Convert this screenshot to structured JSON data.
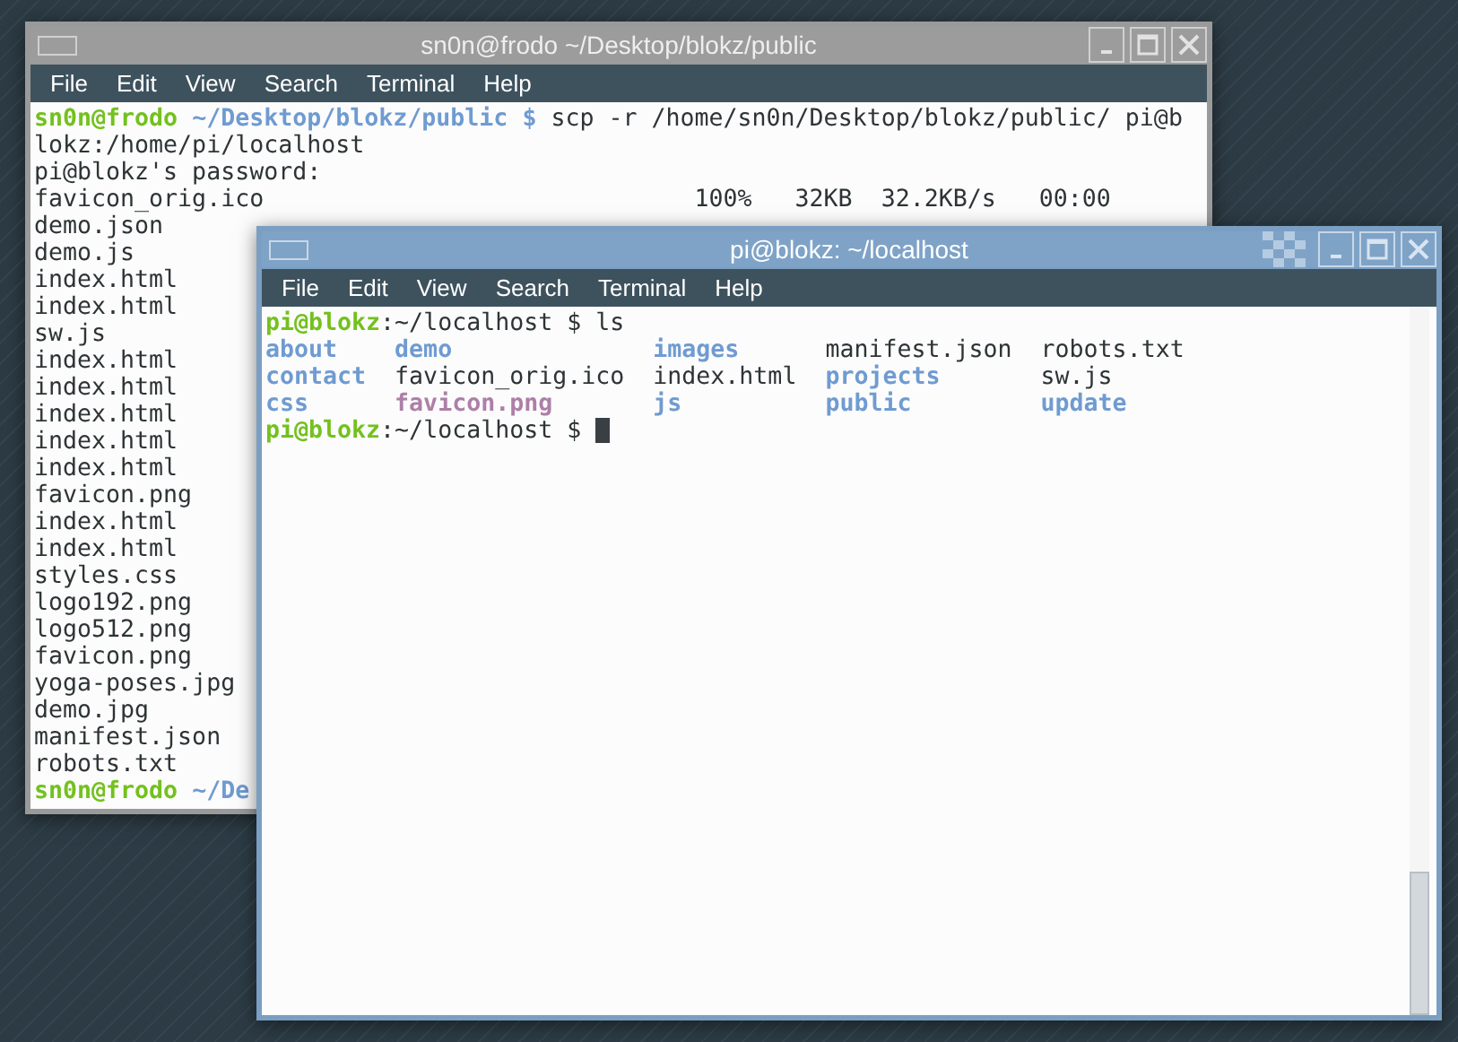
{
  "windows": [
    {
      "title": "sn0n@frodo ~/Desktop/blokz/public",
      "active": false,
      "menu": [
        "File",
        "Edit",
        "View",
        "Search",
        "Terminal",
        "Help"
      ],
      "lines": [
        {
          "kind": "text",
          "segments": [
            {
              "kind": "user",
              "text": "sn0n@frodo"
            },
            {
              "kind": "path",
              "text": " ~/Desktop/blokz/public $"
            },
            {
              "kind": "plain",
              "text": " scp -r /home/sn0n/Desktop/blokz/public/ pi@b"
            }
          ]
        },
        {
          "kind": "text",
          "segments": [
            {
              "kind": "plain",
              "text": "lokz:/home/pi/localhost"
            }
          ]
        },
        {
          "kind": "text",
          "segments": [
            {
              "kind": "plain",
              "text": "pi@blokz's password:"
            }
          ]
        },
        {
          "kind": "text",
          "segments": [
            {
              "kind": "plain",
              "text": "favicon_orig.ico                              100%   32KB  32.2KB/s   00:00"
            }
          ]
        },
        {
          "kind": "text",
          "segments": [
            {
              "kind": "plain",
              "text": "demo.json"
            }
          ]
        },
        {
          "kind": "text",
          "segments": [
            {
              "kind": "plain",
              "text": "demo.js"
            }
          ]
        },
        {
          "kind": "text",
          "segments": [
            {
              "kind": "plain",
              "text": "index.html"
            }
          ]
        },
        {
          "kind": "text",
          "segments": [
            {
              "kind": "plain",
              "text": "index.html"
            }
          ]
        },
        {
          "kind": "text",
          "segments": [
            {
              "kind": "plain",
              "text": "sw.js"
            }
          ]
        },
        {
          "kind": "text",
          "segments": [
            {
              "kind": "plain",
              "text": "index.html"
            }
          ]
        },
        {
          "kind": "text",
          "segments": [
            {
              "kind": "plain",
              "text": "index.html"
            }
          ]
        },
        {
          "kind": "text",
          "segments": [
            {
              "kind": "plain",
              "text": "index.html"
            }
          ]
        },
        {
          "kind": "text",
          "segments": [
            {
              "kind": "plain",
              "text": "index.html"
            }
          ]
        },
        {
          "kind": "text",
          "segments": [
            {
              "kind": "plain",
              "text": "index.html"
            }
          ]
        },
        {
          "kind": "text",
          "segments": [
            {
              "kind": "plain",
              "text": "favicon.png"
            }
          ]
        },
        {
          "kind": "text",
          "segments": [
            {
              "kind": "plain",
              "text": "index.html"
            }
          ]
        },
        {
          "kind": "text",
          "segments": [
            {
              "kind": "plain",
              "text": "index.html"
            }
          ]
        },
        {
          "kind": "text",
          "segments": [
            {
              "kind": "plain",
              "text": "styles.css"
            }
          ]
        },
        {
          "kind": "text",
          "segments": [
            {
              "kind": "plain",
              "text": "logo192.png"
            }
          ]
        },
        {
          "kind": "text",
          "segments": [
            {
              "kind": "plain",
              "text": "logo512.png"
            }
          ]
        },
        {
          "kind": "text",
          "segments": [
            {
              "kind": "plain",
              "text": "favicon.png"
            }
          ]
        },
        {
          "kind": "text",
          "segments": [
            {
              "kind": "plain",
              "text": "yoga-poses.jpg"
            }
          ]
        },
        {
          "kind": "text",
          "segments": [
            {
              "kind": "plain",
              "text": "demo.jpg"
            }
          ]
        },
        {
          "kind": "text",
          "segments": [
            {
              "kind": "plain",
              "text": "manifest.json"
            }
          ]
        },
        {
          "kind": "text",
          "segments": [
            {
              "kind": "plain",
              "text": "robots.txt"
            }
          ]
        },
        {
          "kind": "text",
          "segments": [
            {
              "kind": "user",
              "text": "sn0n@frodo"
            },
            {
              "kind": "path",
              "text": " ~/De"
            }
          ]
        }
      ]
    },
    {
      "title": "pi@blokz: ~/localhost",
      "active": true,
      "menu": [
        "File",
        "Edit",
        "View",
        "Search",
        "Terminal",
        "Help"
      ],
      "lines": [
        {
          "kind": "text",
          "segments": [
            {
              "kind": "user",
              "text": "pi@blokz"
            },
            {
              "kind": "plain",
              "text": ":~/localhost $ ls"
            }
          ]
        },
        {
          "kind": "columns",
          "cells": [
            {
              "kind": "dir",
              "text": "about"
            },
            {
              "kind": "dir",
              "text": "demo"
            },
            {
              "kind": "dir",
              "text": "images"
            },
            {
              "kind": "plain",
              "text": "manifest.json"
            },
            {
              "kind": "plain",
              "text": "robots.txt"
            }
          ]
        },
        {
          "kind": "columns",
          "cells": [
            {
              "kind": "dir",
              "text": "contact"
            },
            {
              "kind": "plain",
              "text": "favicon_orig.ico"
            },
            {
              "kind": "plain",
              "text": "index.html"
            },
            {
              "kind": "dir",
              "text": "projects"
            },
            {
              "kind": "plain",
              "text": "sw.js"
            }
          ]
        },
        {
          "kind": "columns",
          "cells": [
            {
              "kind": "dir",
              "text": "css"
            },
            {
              "kind": "image",
              "text": "favicon.png"
            },
            {
              "kind": "dir",
              "text": "js"
            },
            {
              "kind": "dir",
              "text": "public"
            },
            {
              "kind": "dir",
              "text": "update"
            }
          ]
        },
        {
          "kind": "text",
          "cursor": true,
          "segments": [
            {
              "kind": "user",
              "text": "pi@blokz"
            },
            {
              "kind": "plain",
              "text": ":~/localhost $ "
            }
          ]
        }
      ]
    }
  ]
}
